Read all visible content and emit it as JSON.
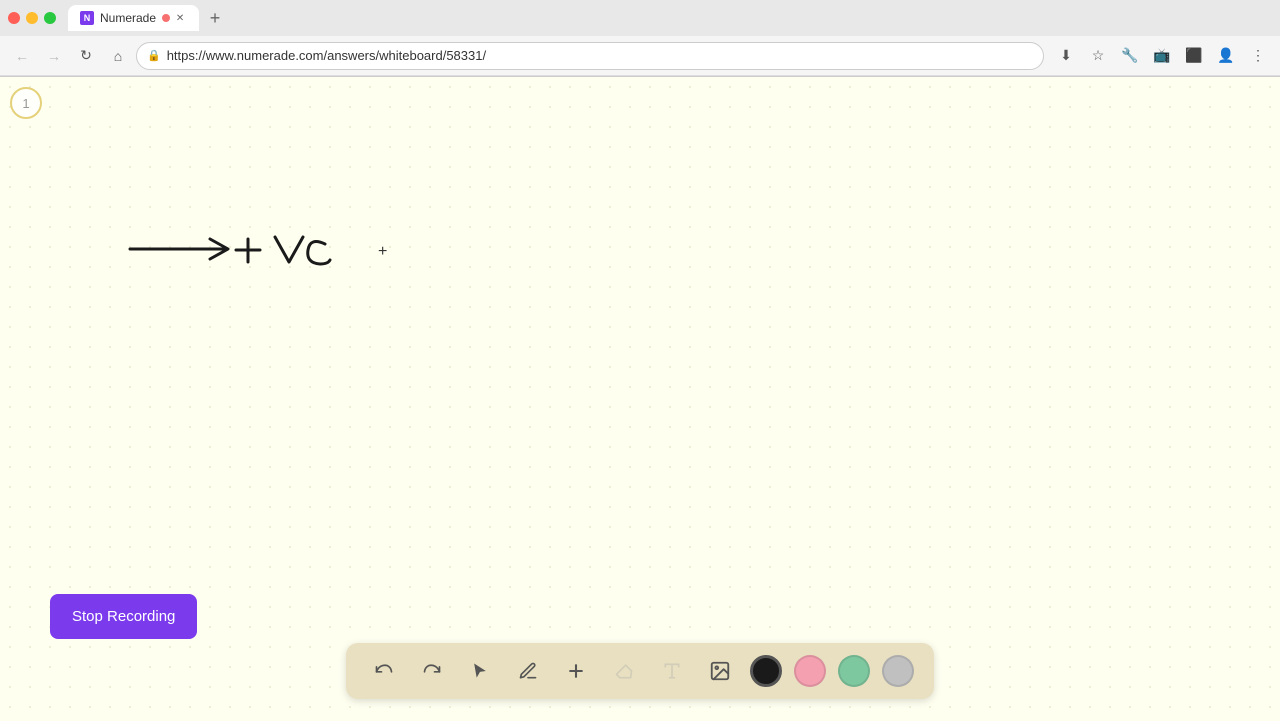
{
  "browser": {
    "tab": {
      "title": "Numerade",
      "favicon_label": "N",
      "url": "https://www.numerade.com/answers/whiteboard/58331/"
    },
    "new_tab_label": "+",
    "nav": {
      "back_label": "←",
      "forward_label": "→",
      "refresh_label": "↻",
      "home_label": "⌂"
    },
    "address": "https://www.numerade.com/answers/whiteboard/58331/"
  },
  "whiteboard": {
    "page_number": "1",
    "cursor_symbol": "+"
  },
  "stop_recording": {
    "label": "Stop Recording"
  },
  "bottom_toolbar": {
    "undo_label": "↺",
    "redo_label": "↻",
    "select_label": "▲",
    "pen_label": "✏",
    "add_label": "+",
    "eraser_label": "/",
    "text_label": "A",
    "image_label": "🖼",
    "colors": [
      {
        "name": "black",
        "hex": "#1a1a1a"
      },
      {
        "name": "pink",
        "hex": "#f4a0b0"
      },
      {
        "name": "green",
        "hex": "#7ec8a0"
      },
      {
        "name": "gray",
        "hex": "#c0c0c0"
      }
    ]
  }
}
